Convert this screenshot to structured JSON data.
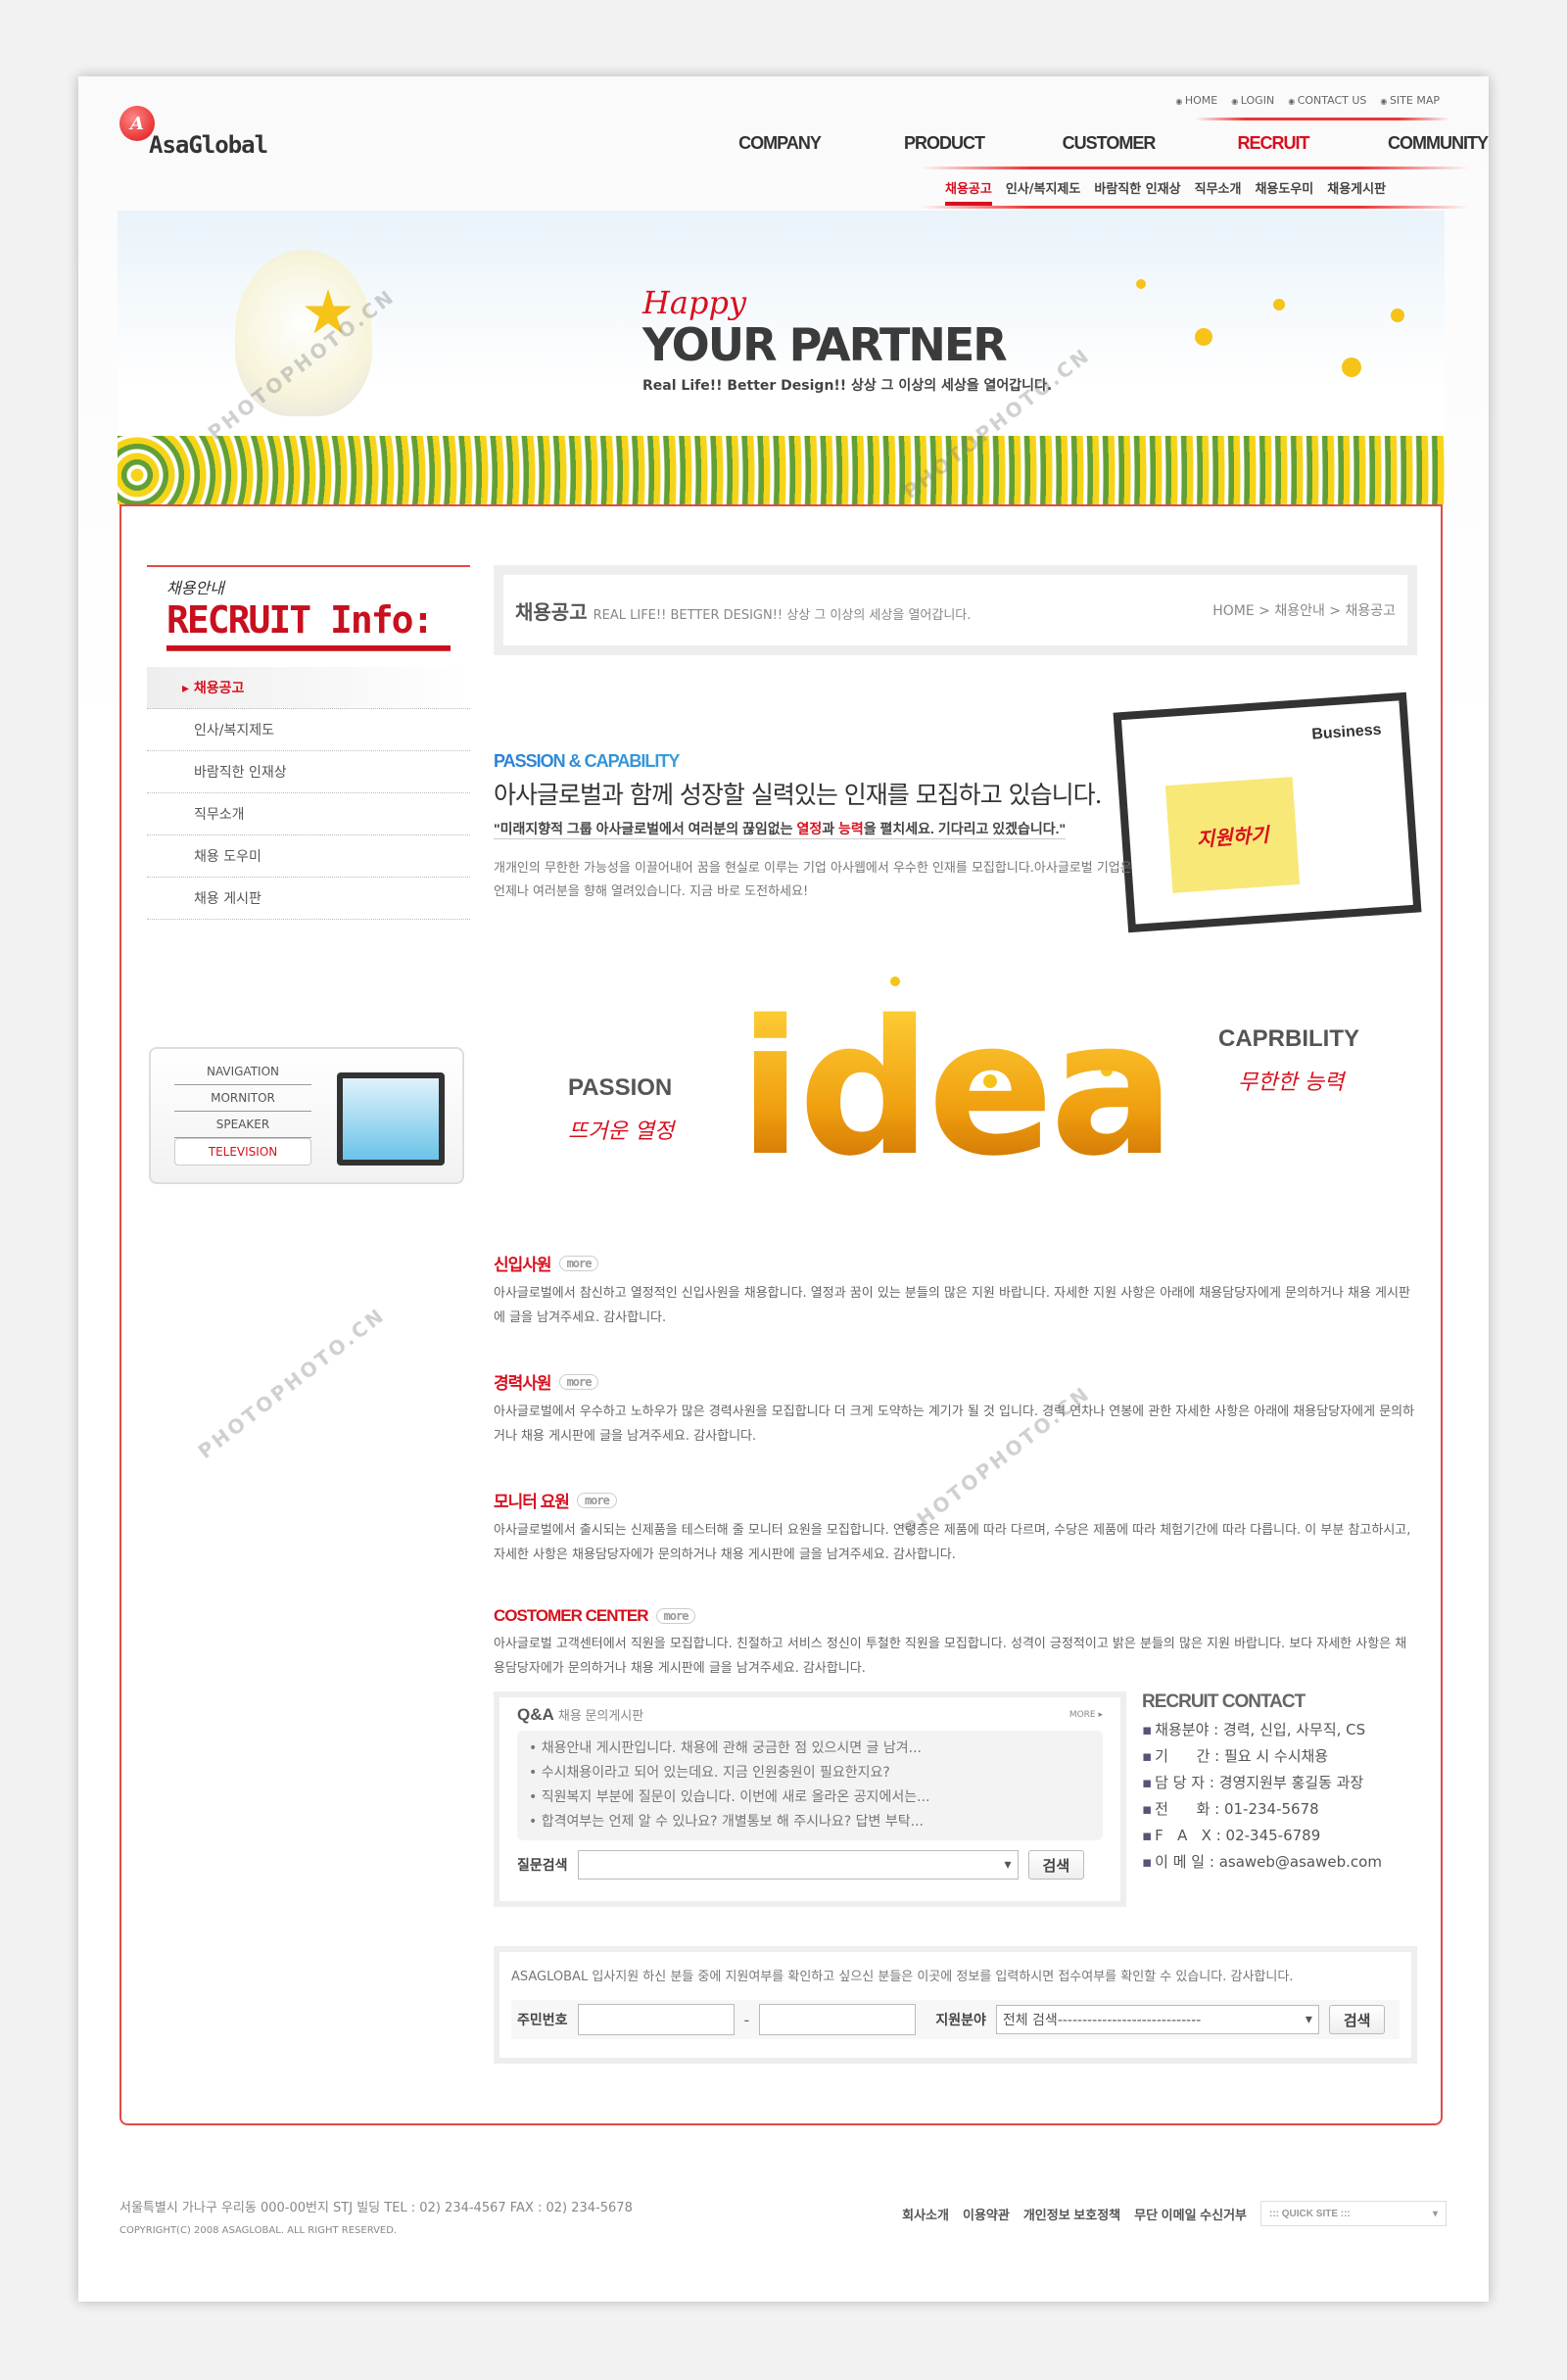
{
  "colors": {
    "accent": "#d8101e",
    "border": "#e04a4a",
    "text": "#666666"
  },
  "top_links": [
    "HOME",
    "LOGIN",
    "CONTACT US",
    "SITE MAP"
  ],
  "logo": {
    "mark": "A",
    "name": "AsaGlobal"
  },
  "main_nav": [
    {
      "label": "COMPANY"
    },
    {
      "label": "PRODUCT"
    },
    {
      "label": "CUSTOMER"
    },
    {
      "label": "RECRUIT",
      "active": true
    },
    {
      "label": "COMMUNITY"
    }
  ],
  "sub_nav": [
    {
      "label": "채용공고",
      "active": true
    },
    {
      "label": "인사/복지제도"
    },
    {
      "label": "바람직한 인재상"
    },
    {
      "label": "직무소개"
    },
    {
      "label": "채용도우미"
    },
    {
      "label": "채용게시판"
    }
  ],
  "banner": {
    "happy": "Happy",
    "title": "YOUR PARTNER",
    "tagline": "Real Life!! Better Design!! 상상 그 이상의 세상을 열어갑니다."
  },
  "sidebar": {
    "hand": "채용안내",
    "title": "RECRUIT Info:",
    "items": [
      {
        "label": "채용공고",
        "active": true
      },
      {
        "label": "인사/복지제도"
      },
      {
        "label": "바람직한 인재상"
      },
      {
        "label": "직무소개"
      },
      {
        "label": "채용 도우미"
      },
      {
        "label": "채용 게시판"
      }
    ],
    "navbox": [
      "NAVIGATION",
      "MORNITOR",
      "SPEAKER",
      "TELEVISION"
    ]
  },
  "titlebar": {
    "title": "채용공고",
    "subtitle": "REAL LIFE!! BETTER DESIGN!! 상상 그 이상의 세상을 열어갑니다.",
    "breadcrumb": "HOME > 채용안내 > 채용공고"
  },
  "intro": {
    "kicker": "PASSION & CAPABILITY",
    "headline": "아사글로벌과 함께 성장할 실력있는 인재를 모집하고 있습니다.",
    "quote_pre": "\"미래지향적 그룹 아사글로벌에서 여러분의 끊임없는 ",
    "quote_b1": "열정",
    "quote_mid": "과 ",
    "quote_b2": "능력",
    "quote_post": "을 펼치세요. 기다리고 있겠습니다.\"",
    "desc": "개개인의 무한한 가능성을 이끌어내어 꿈을 현실로 이루는 기업 아사웹에서 우수한 인재를 모집합니다.아사글로벌 기업은 언제나 여러분을 향해 열려있습니다. 지금 바로 도전하세요!",
    "note": "지원하기",
    "board": "Business"
  },
  "idea": {
    "word": "idea",
    "passion": "PASSION",
    "passion_ko": "뜨거운 열정",
    "capability": "CAPRBILITY",
    "capability_ko": "무한한 능력"
  },
  "jobs": [
    {
      "title": "신입사원",
      "more": "more",
      "text": "아사글로벌에서 참신하고 열정적인  신입사원을 채용합니다. 열정과 꿈이 있는 분들의 많은 지원 바랍니다. 자세한 지원 사항은 아래에 채용담당자에게 문의하거나 채용 게시판에 글을 남겨주세요.  감사합니다."
    },
    {
      "title": "경력사원",
      "more": "more",
      "text": "아사글로벌에서 우수하고 노하우가 많은 경력사원을 모집합니다  더 크게 도약하는 계기가 될 것 입니다. 경력 연차나 연봉에 관한 자세한 사항은 아래에 채용담당자에게 문의하거나 채용 게시판에 글을 남겨주세요. 감사합니다."
    },
    {
      "title": "모니터 요원",
      "more": "more",
      "text": "아사글로벌에서 출시되는 신제품을 테스터해 줄 모니터 요원을 모집합니다. 연령층은 제품에 따라 다르며, 수당은 제품에 따라 체험기간에 따라 다릅니다. 이 부분 참고하시고, 자세한 사항은 채용담당자에가 문의하거나 채용 게시판에 글을 남겨주세요. 감사합니다."
    },
    {
      "title": "COSTOMER CENTER",
      "more": "more",
      "text": "아사글로벌 고객센터에서 직원을 모집합니다. 친절하고 서비스 정신이 투철한 직원을 모집합니다. 성격이 긍정적이고 밝은 분들의 많은 지원 바랍니다.  보다 자세한 사항은 채용담당자에가 문의하거나 채용 게시판에 글을 남겨주세요. 감사합니다."
    }
  ],
  "qa": {
    "title": "Q&A",
    "subtitle": "채용 문의게시판",
    "more": "MORE ▸",
    "items": [
      "채용안내 게시판입니다. 채용에 관해 궁금한 점 있으시면 글 남겨...",
      "수시채용이라고 되어 있는데요. 지금 인원충원이 필요한지요?",
      "직원복지 부분에 질문이 있습니다. 이번에 새로 올라온 공지에서는...",
      "합격여부는 언제 알 수 있나요? 개별통보 해 주시나요? 답변 부탁..."
    ],
    "search_label": "질문검색",
    "search_value": "",
    "search_button": "검색"
  },
  "contact": {
    "title": "RECRUIT CONTACT",
    "rows": [
      "채용분야 : 경력, 신입, 사무직, CS",
      "기      간 : 필요 시 수시채용",
      "담 당 자 : 경영지원부 홍길동 과장",
      "전      화 : 01-234-5678",
      "F   A   X : 02-345-6789",
      "이 메 일 : asaweb@asaweb.com"
    ]
  },
  "check": {
    "desc": "ASAGLOBAL 입사지원 하신 분들 중에 지원여부를 확인하고 싶으신 분들은 이곳에 정보를 입력하시면 접수여부를 확인할 수 있습니다. 감사합니다.",
    "id_label": "주민번호",
    "dash": "-",
    "id1": "",
    "id2": "",
    "field_label": "지원분야",
    "field_value": "전체 검색-----------------------------",
    "button": "검색"
  },
  "footer": {
    "address": "서울특별시 가나구 우리동 000-00번지 STJ 빌딩  TEL : 02) 234-4567  FAX : 02) 234-5678",
    "copyright": "COPYRIGHT(C) 2008 ASAGLOBAL.  ALL RIGHT RESERVED.",
    "links": [
      "회사소개",
      "이용약관",
      "개인정보 보호정책",
      "무단 이메일 수신거부"
    ],
    "quick_site": "::: QUICK SITE :::"
  },
  "watermark": "PHOTOPHOTO.CN"
}
